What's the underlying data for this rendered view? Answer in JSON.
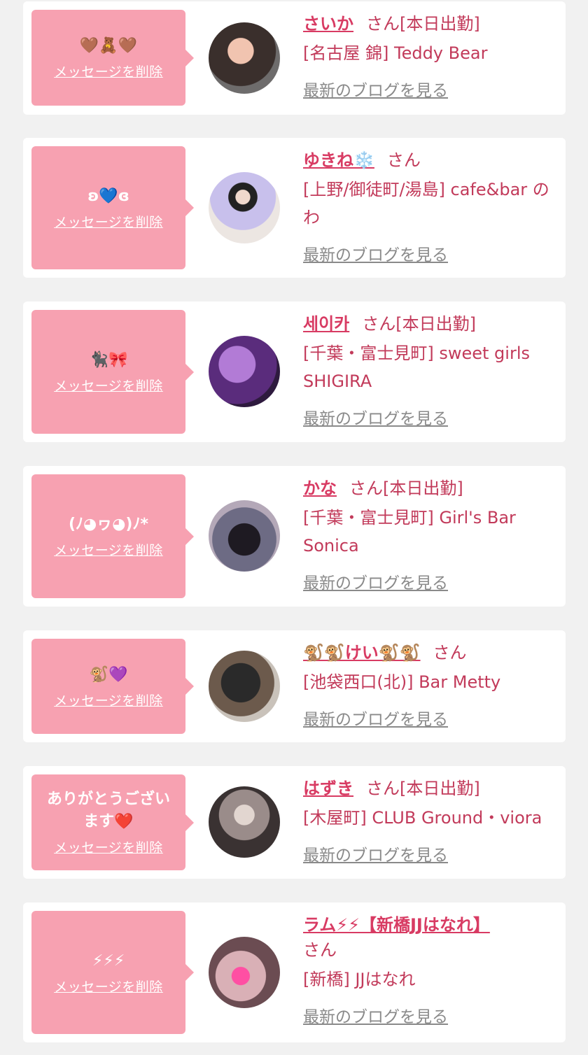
{
  "delete_label": "メッセージを削除",
  "blog_label": "最新のブログを見る",
  "colors": {
    "bubble": "#f7a1b1",
    "name": "#d83b63",
    "text": "#c23a5a",
    "link": "#8a8a8a"
  },
  "items": [
    {
      "message": "🤎🧸🤎",
      "name": "さいか",
      "suffix": "さん[本日出勤]",
      "shop": "[名古屋 錦] Teddy Bear"
    },
    {
      "message": "ʚ💙ɞ",
      "name": "ゆきね❄️",
      "suffix": "さん",
      "shop": "[上野/御徒町/湯島] cafe&bar のわ"
    },
    {
      "message": "🐈‍⬛🎀",
      "name": "세이카",
      "suffix": "さん[本日出勤]",
      "shop": "[千葉・富士見町] sweet girls SHIGIRA"
    },
    {
      "message": "(ﾉ◕ヮ◕)ﾉ*",
      "name": "かな",
      "suffix": "さん[本日出勤]",
      "shop": "[千葉・富士見町] Girl's Bar Sonica"
    },
    {
      "message": "🐒💜",
      "name": "🐒🐒けい🐒🐒",
      "suffix": "さん",
      "shop": "[池袋西口(北)] Bar Metty"
    },
    {
      "message": "ありがとうございます❤️",
      "name": "はずき",
      "suffix": "さん[本日出勤]",
      "shop": "[木屋町] CLUB Ground・viora"
    },
    {
      "message": "⚡⚡⚡",
      "name": "ラム⚡⚡【新橋JJはなれ】",
      "suffix": "さん",
      "shop": "[新橋] JJはなれ"
    }
  ]
}
